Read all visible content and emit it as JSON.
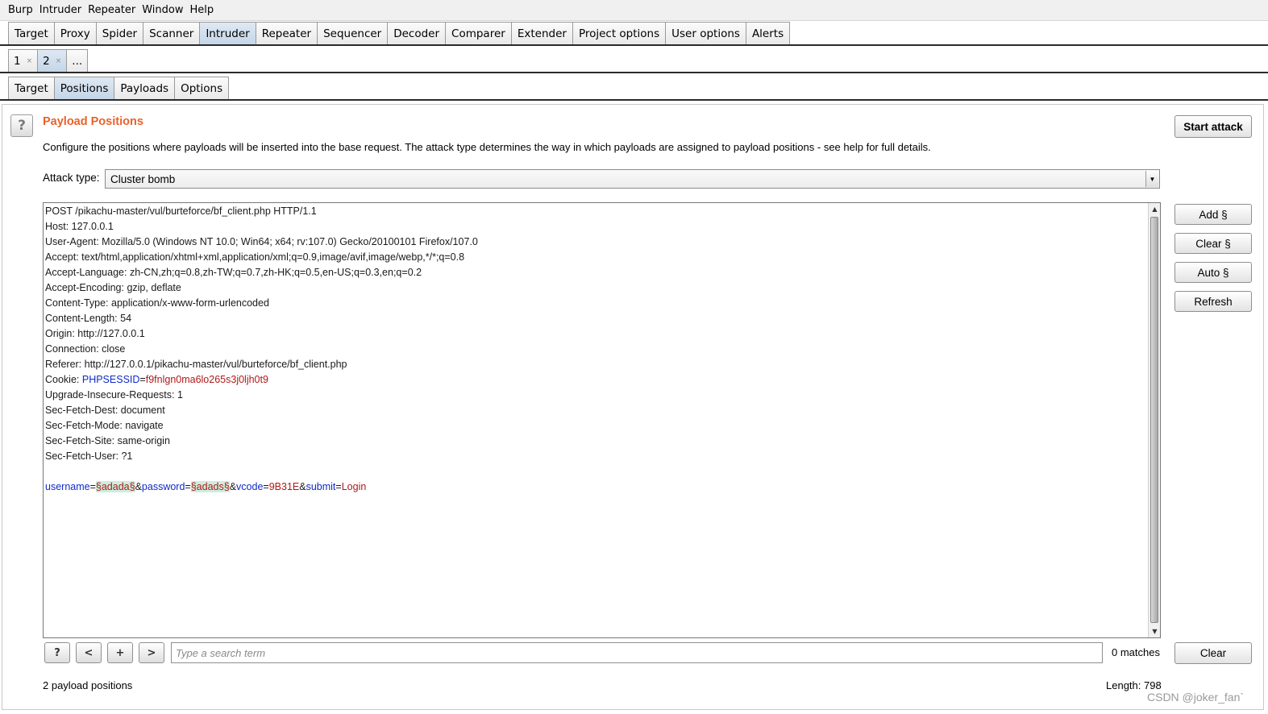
{
  "menu": [
    "Burp",
    "Intruder",
    "Repeater",
    "Window",
    "Help"
  ],
  "main_tabs": [
    {
      "label": "Target"
    },
    {
      "label": "Proxy"
    },
    {
      "label": "Spider"
    },
    {
      "label": "Scanner"
    },
    {
      "label": "Intruder",
      "active": true
    },
    {
      "label": "Repeater"
    },
    {
      "label": "Sequencer"
    },
    {
      "label": "Decoder"
    },
    {
      "label": "Comparer"
    },
    {
      "label": "Extender"
    },
    {
      "label": "Project options"
    },
    {
      "label": "User options"
    },
    {
      "label": "Alerts"
    }
  ],
  "attack_tabs": [
    {
      "label": "1",
      "close": "×"
    },
    {
      "label": "2",
      "close": "×",
      "active": true
    },
    {
      "label": "..."
    }
  ],
  "config_tabs": [
    {
      "label": "Target"
    },
    {
      "label": "Positions",
      "active": true
    },
    {
      "label": "Payloads"
    },
    {
      "label": "Options"
    }
  ],
  "positions": {
    "help_icon": "?",
    "title": "Payload Positions",
    "description": "Configure the positions where payloads will be inserted into the base request. The attack type determines the way in which payloads are assigned to payload positions - see help for full details.",
    "start_attack_label": "Start attack",
    "attack_type_label": "Attack type:",
    "attack_type_value": "Cluster bomb",
    "dropdown_arrow": "▼"
  },
  "request_lines": [
    "POST /pikachu-master/vul/burteforce/bf_client.php HTTP/1.1",
    "Host: 127.0.0.1",
    "User-Agent: Mozilla/5.0 (Windows NT 10.0; Win64; x64; rv:107.0) Gecko/20100101 Firefox/107.0",
    "Accept: text/html,application/xhtml+xml,application/xml;q=0.9,image/avif,image/webp,*/*;q=0.8",
    "Accept-Language: zh-CN,zh;q=0.8,zh-TW;q=0.7,zh-HK;q=0.5,en-US;q=0.3,en;q=0.2",
    "Accept-Encoding: gzip, deflate",
    "Content-Type: application/x-www-form-urlencoded",
    "Content-Length: 54",
    "Origin: http://127.0.0.1",
    "Connection: close",
    "Referer: http://127.0.0.1/pikachu-master/vul/burteforce/bf_client.php"
  ],
  "cookie": {
    "prefix": "Cookie: ",
    "name": "PHPSESSID",
    "eq": "=",
    "value": "f9fnlgn0ma6lo265s3j0ljh0t9"
  },
  "request_lines_2": [
    "Upgrade-Insecure-Requests: 1",
    "Sec-Fetch-Dest: document",
    "Sec-Fetch-Mode: navigate",
    "Sec-Fetch-Site: same-origin",
    "Sec-Fetch-User: ?1",
    ""
  ],
  "body_tokens": [
    {
      "t": "username",
      "c": "kw"
    },
    {
      "t": "=",
      "c": ""
    },
    {
      "t": "§adada§",
      "c": "payload"
    },
    {
      "t": "&",
      "c": ""
    },
    {
      "t": "password",
      "c": "kw"
    },
    {
      "t": "=",
      "c": ""
    },
    {
      "t": "§adads§",
      "c": "payload"
    },
    {
      "t": "&",
      "c": ""
    },
    {
      "t": "vcode",
      "c": "kw"
    },
    {
      "t": "=",
      "c": ""
    },
    {
      "t": "9B31E",
      "c": "val"
    },
    {
      "t": "&",
      "c": ""
    },
    {
      "t": "submit",
      "c": "kw"
    },
    {
      "t": "=",
      "c": ""
    },
    {
      "t": "Login",
      "c": "val"
    }
  ],
  "scroll_up": "▲",
  "scroll_down": "▼",
  "side_buttons": {
    "add": "Add §",
    "clear": "Clear §",
    "auto": "Auto §",
    "refresh": "Refresh"
  },
  "search": {
    "help": "?",
    "prev": "<",
    "next_add": "+",
    "next": ">",
    "placeholder": "Type a search term",
    "matches": "0 matches",
    "clear_label": "Clear"
  },
  "footer": {
    "payload_positions": "2 payload positions",
    "length": "Length: 798"
  },
  "watermark": "CSDN @joker_fan`",
  "colors": {
    "title": "#e8622a",
    "keyword": "#0f2ac7",
    "value": "#b01818",
    "payload_bg": "#cdeede"
  }
}
